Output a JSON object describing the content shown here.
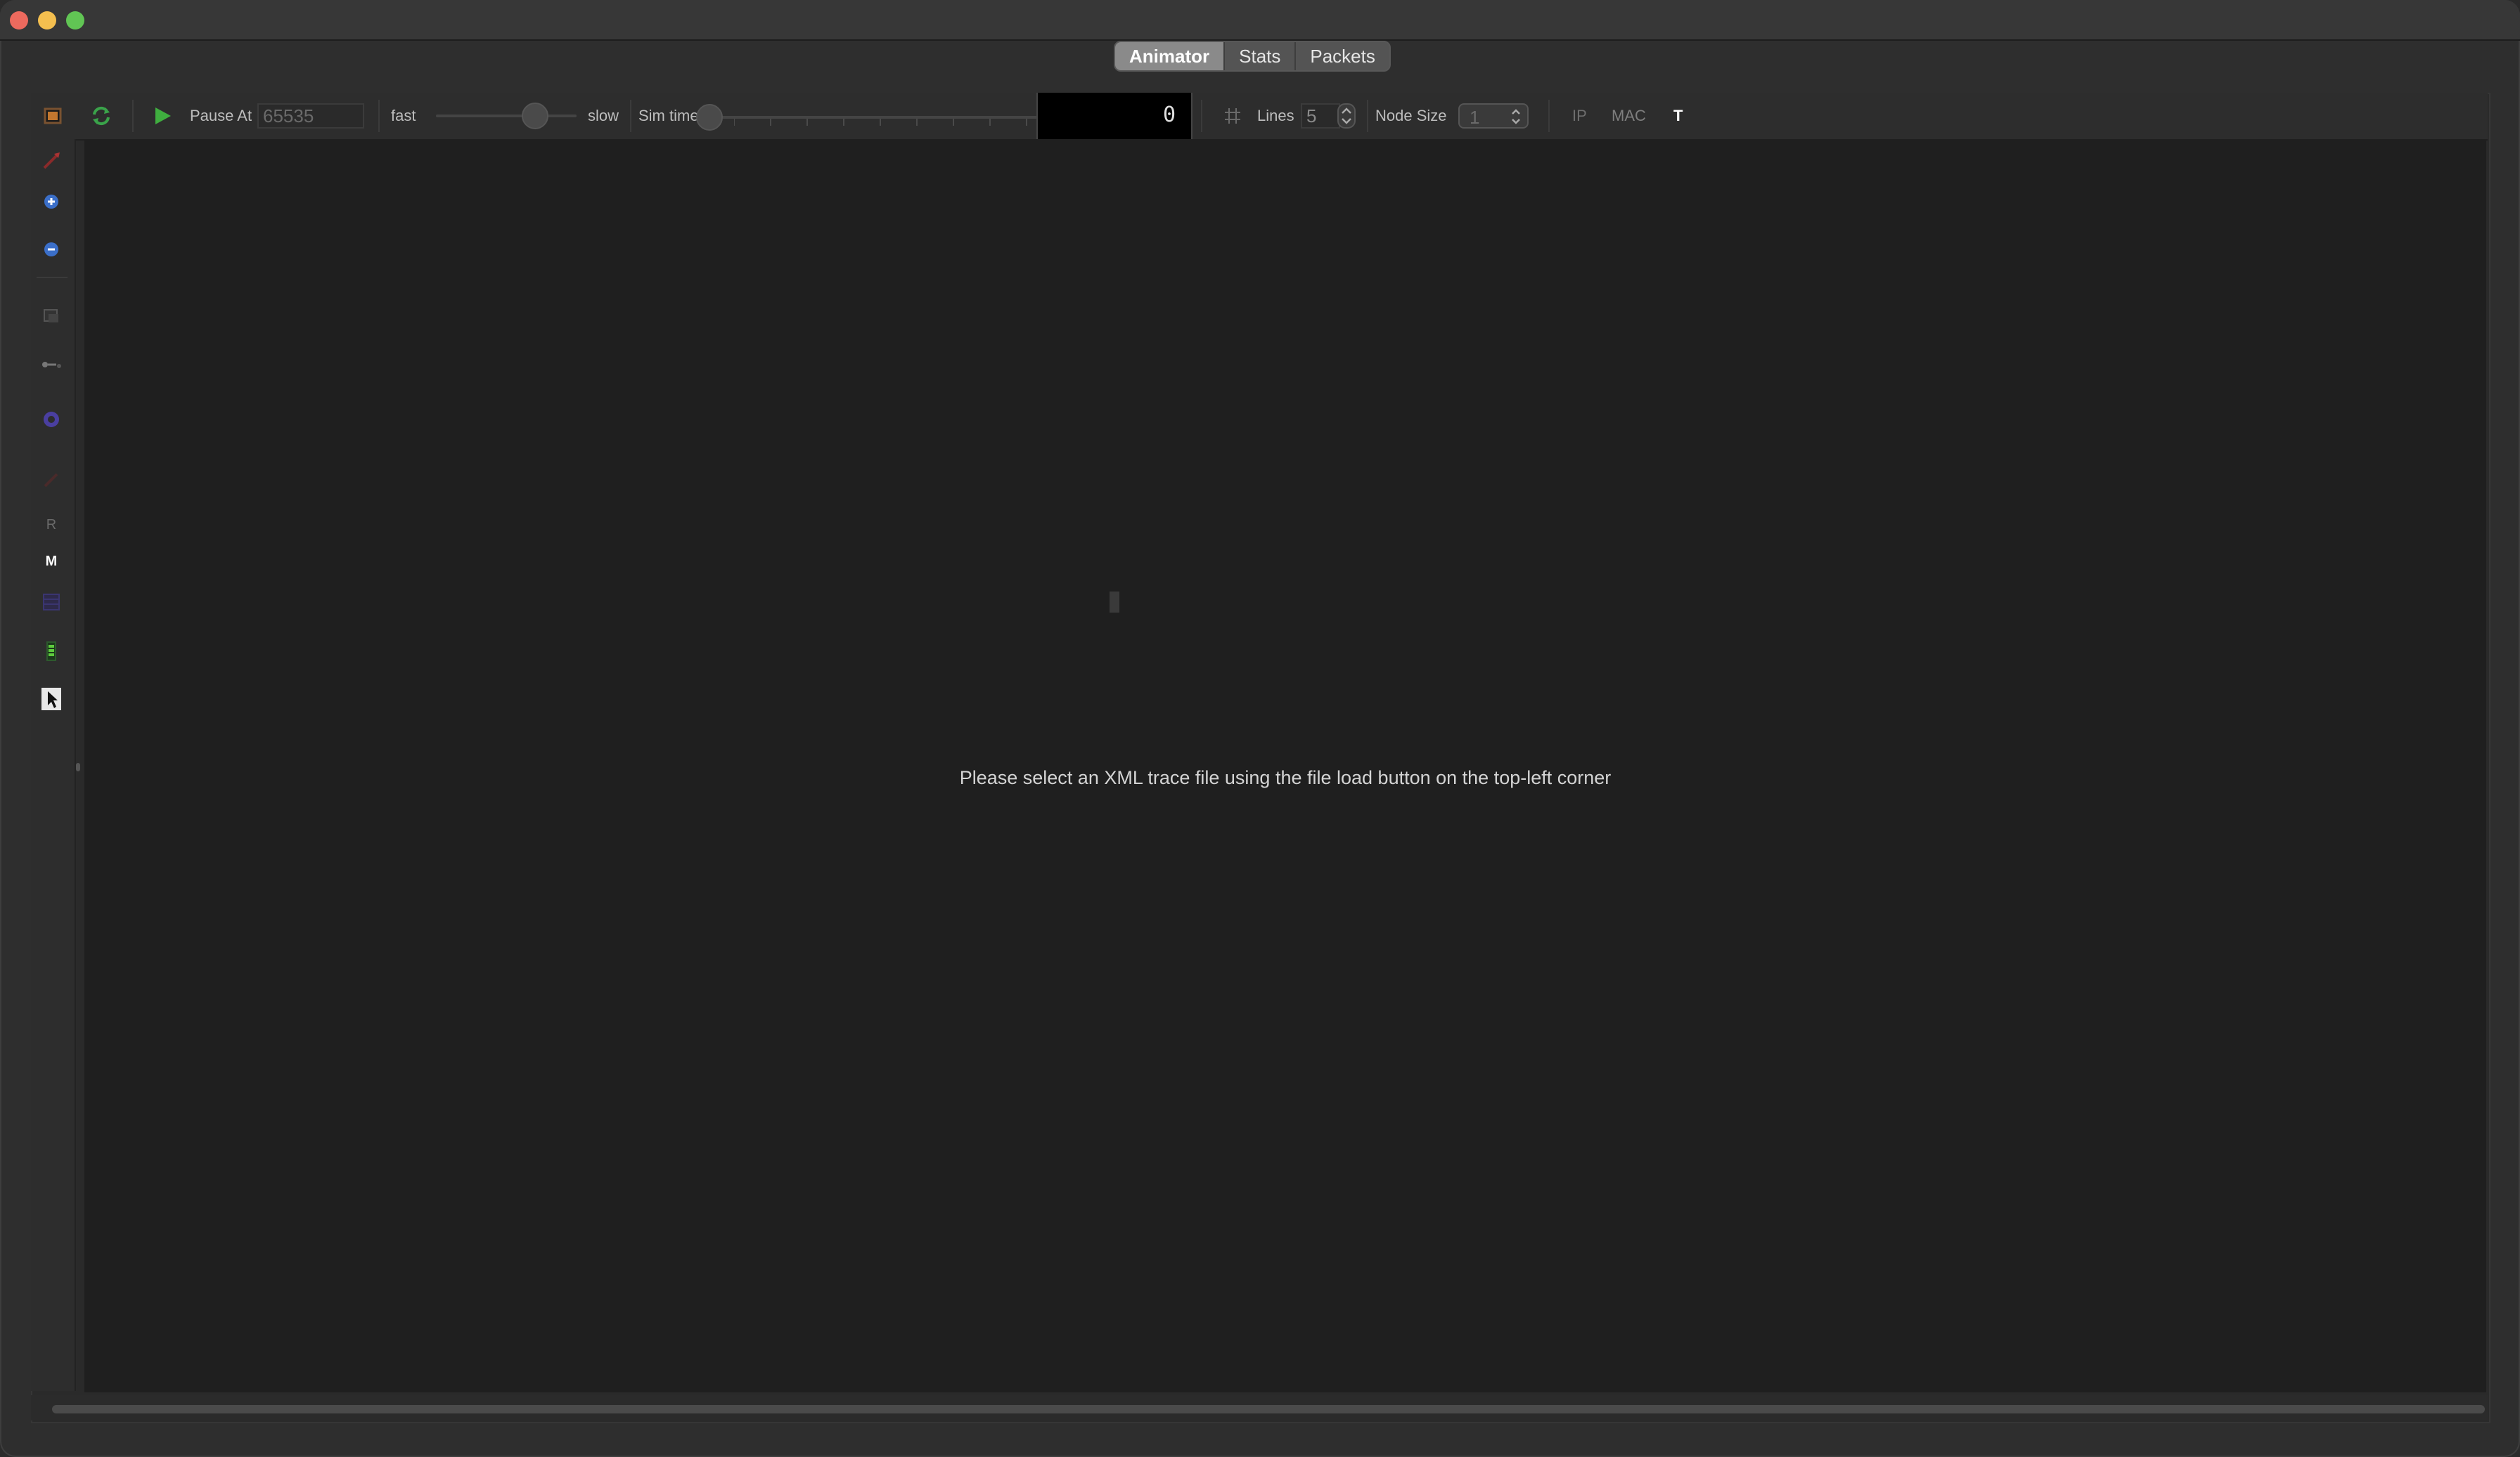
{
  "tabs": [
    {
      "label": "Animator",
      "active": true
    },
    {
      "label": "Stats",
      "active": false
    },
    {
      "label": "Packets",
      "active": false
    }
  ],
  "toolbar": {
    "pause_at_label": "Pause At",
    "pause_at_value": "65535",
    "fast_label": "fast",
    "slow_label": "slow",
    "sim_time_label": "Sim time",
    "sim_time_display": "0",
    "lines_label": "Lines",
    "lines_value": "5",
    "node_size_label": "Node Size",
    "node_size_value": "1",
    "ip_label": "IP",
    "mac_label": "MAC",
    "t_label": "T"
  },
  "sidebar": {
    "r_label": "R",
    "m_label": "M"
  },
  "main": {
    "message": "Please select an XML trace file using the file load button on the top-left corner"
  },
  "colors": {
    "play_green": "#3fae3f",
    "accent_blue": "#3b6fc9",
    "close_red": "#ed6a5e"
  }
}
